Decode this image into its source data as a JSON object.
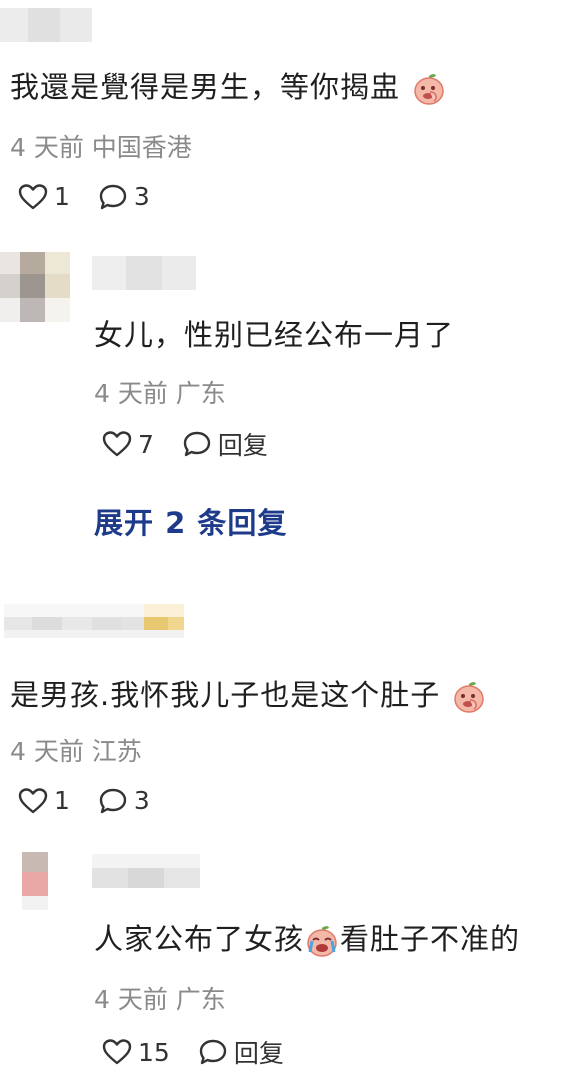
{
  "colors": {
    "link": "#1e3a8a",
    "meta": "#8a8a8a"
  },
  "comments": [
    {
      "text": "我還是覺得是男生，等你揭盅",
      "emoji": "peach-face-emoji",
      "meta": "4 天前 中国香港",
      "likes": "1",
      "replies": "3"
    },
    {
      "text": "女儿，性别已经公布一月了",
      "meta": "4 天前 广东",
      "likes": "7",
      "reply_label": "回复"
    },
    {
      "text": "是男孩.我怀我儿子也是这个肚子",
      "emoji": "peach-face-emoji",
      "meta": "4 天前 江苏",
      "likes": "1",
      "replies": "3"
    },
    {
      "text_before": "人家公布了女孩",
      "emoji": "crying-face-emoji",
      "text_after": "看肚子不准的",
      "meta": "4 天前 广东",
      "likes": "15",
      "reply_label": "回复"
    }
  ],
  "expand_label": "展开 2 条回复"
}
